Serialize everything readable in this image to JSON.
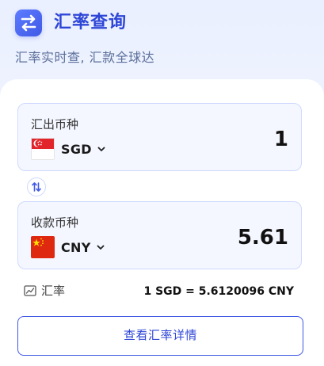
{
  "header": {
    "title": "汇率查询",
    "subtitle": "汇率实时查, 汇款全球达",
    "icon": "exchange-icon",
    "accent_color": "#3f59e6"
  },
  "from_field": {
    "label": "汇出币种",
    "currency": "SGD",
    "flag_icon": "singapore-flag-icon",
    "amount": "1"
  },
  "to_field": {
    "label": "收款币种",
    "currency": "CNY",
    "flag_icon": "china-flag-icon",
    "amount": "5.61"
  },
  "swap_icon": "swap-vertical-icon",
  "rate": {
    "label": "汇率",
    "icon": "line-chart-icon",
    "value": "1 SGD = 5.6120096 CNY"
  },
  "detail_button": {
    "label": "查看汇率详情"
  }
}
